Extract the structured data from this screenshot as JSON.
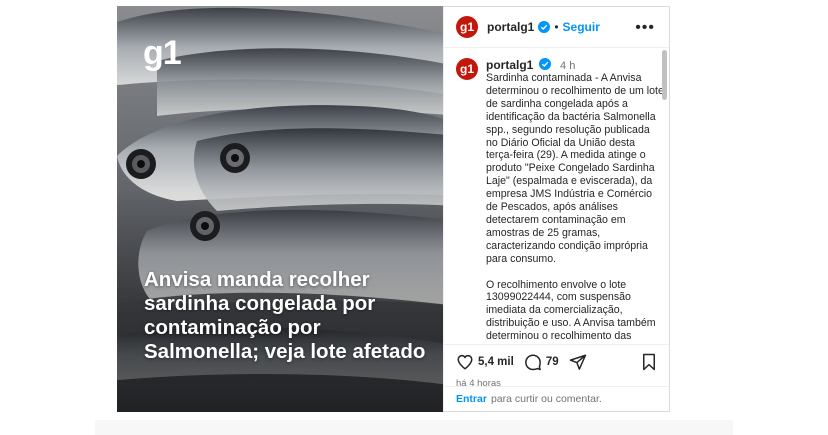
{
  "media": {
    "brand": "g1",
    "headline": "Anvisa manda recolher sardinha congelada por contaminação por Salmonella; veja lote afetado"
  },
  "header": {
    "avatar_text": "g1",
    "username": "portalg1",
    "separator": "•",
    "follow_label": "Seguir",
    "more_label": "•••"
  },
  "caption": {
    "avatar_text": "g1",
    "username": "portalg1",
    "time": "4 h",
    "text": "Sardinha contaminada - A Anvisa determinou o recolhimento de um lote de sardinha congelada após a identificação da bactéria Salmonella spp., segundo resolução publicada no Diário Oficial da União desta terça-feira (29). A medida atinge o produto \"Peixe Congelado Sardinha Laje\" (espalmada e eviscerada), da empresa JMS Indústria e Comércio de Pescados, após análises detectarem contaminação em amostras de 25 gramas, caracterizando condição imprópria para consumo.\n\nO recolhimento envolve o lote 13099022444, com suspensão imediata da comercialização, distribuição e uso. A Anvisa também determinou o recolhimento das unidades já disponíveis no mercado. Segundo a agência, esse tipo de"
  },
  "actions": {
    "likes": "5,4 mil",
    "comments": "79",
    "time_ago": "há 4 horas"
  },
  "comment_box": {
    "enter_label": "Entrar",
    "placeholder": "para curtir ou comentar."
  },
  "colors": {
    "brand_red": "#c4170c",
    "link_blue": "#0095f6"
  }
}
